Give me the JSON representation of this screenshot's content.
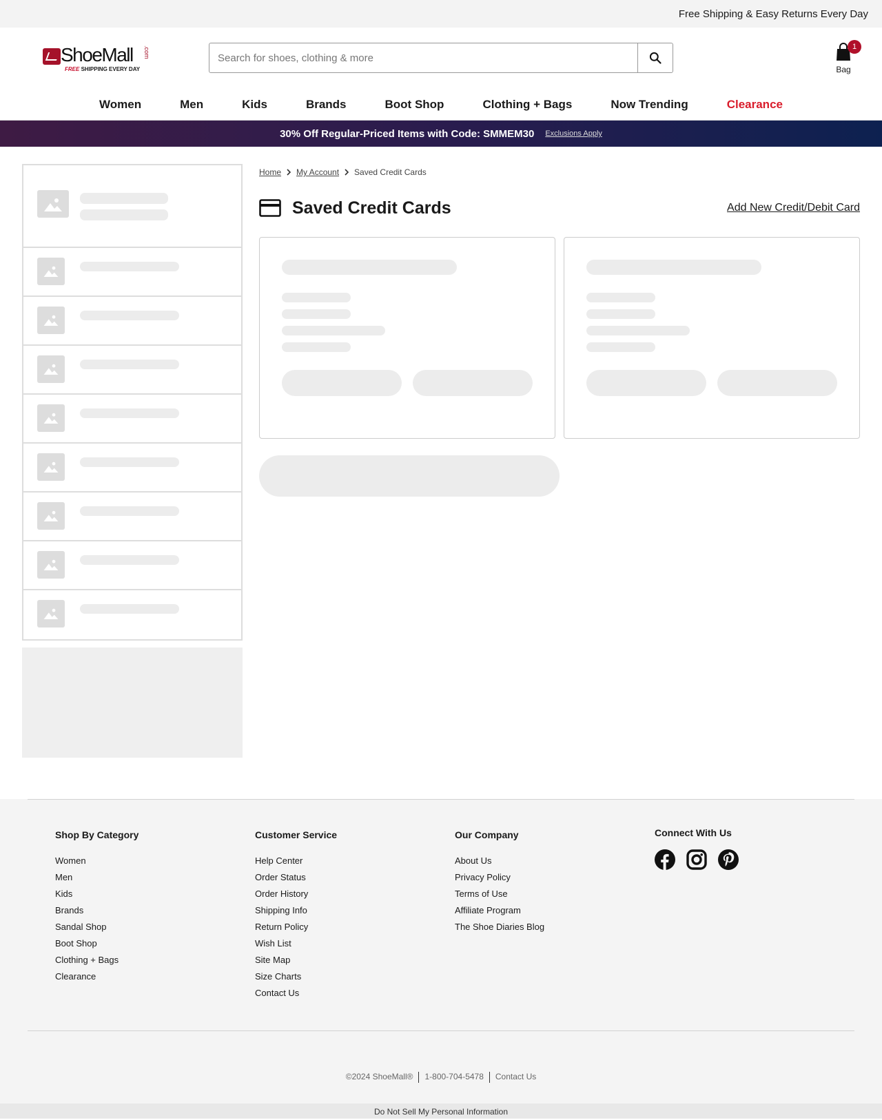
{
  "topbar": {
    "shipping_text": "Free Shipping & Easy Returns Every Day"
  },
  "logo": {
    "name": "ShoeMall",
    "com": ".com",
    "tag_red": "FREE",
    "tag_rest": "SHIPPING EVERY DAY"
  },
  "search": {
    "placeholder": "Search for shoes, clothing & more",
    "value": "",
    "icon": "search-icon"
  },
  "bag": {
    "label": "Bag",
    "count": "1",
    "icon": "shopping-bag-icon"
  },
  "nav": {
    "items": [
      "Women",
      "Men",
      "Kids",
      "Brands",
      "Boot Shop",
      "Clothing + Bags",
      "Now Trending"
    ],
    "clearance": "Clearance",
    "clearance_color": "#d91c2b"
  },
  "promo": {
    "text": "30% Off Regular-Priced Items with Code: SMMEM30",
    "link": "Exclusions Apply",
    "gradient": [
      "#3e1b44",
      "#0d2150"
    ]
  },
  "breadcrumb": {
    "home": "Home",
    "account": "My Account",
    "current": "Saved Credit Cards"
  },
  "page": {
    "title": "Saved Credit Cards",
    "icon": "credit-card-icon",
    "add_link": "Add New Credit/Debit Card"
  },
  "footer": {
    "col1": {
      "heading": "Shop By Category",
      "links": [
        "Women",
        "Men",
        "Kids",
        "Brands",
        "Sandal Shop",
        "Boot Shop",
        "Clothing + Bags",
        "Clearance"
      ]
    },
    "col2": {
      "heading": "Customer Service",
      "links": [
        "Help Center",
        "Order Status",
        "Order History",
        "Shipping Info",
        "Return Policy",
        "Wish List",
        "Site Map",
        "Size Charts",
        "Contact Us"
      ]
    },
    "col3": {
      "heading": "Our Company",
      "links": [
        "About Us",
        "Privacy Policy",
        "Terms of Use",
        "Affiliate Program",
        "The Shoe Diaries Blog"
      ]
    },
    "col4": {
      "heading": "Connect With Us",
      "icons": [
        "facebook-icon",
        "instagram-icon",
        "pinterest-icon"
      ]
    },
    "copyright": "©2024 ShoeMall®",
    "phone": "1-800-704-5478",
    "contact": "Contact Us",
    "dns": "Do Not Sell My Personal Information"
  }
}
